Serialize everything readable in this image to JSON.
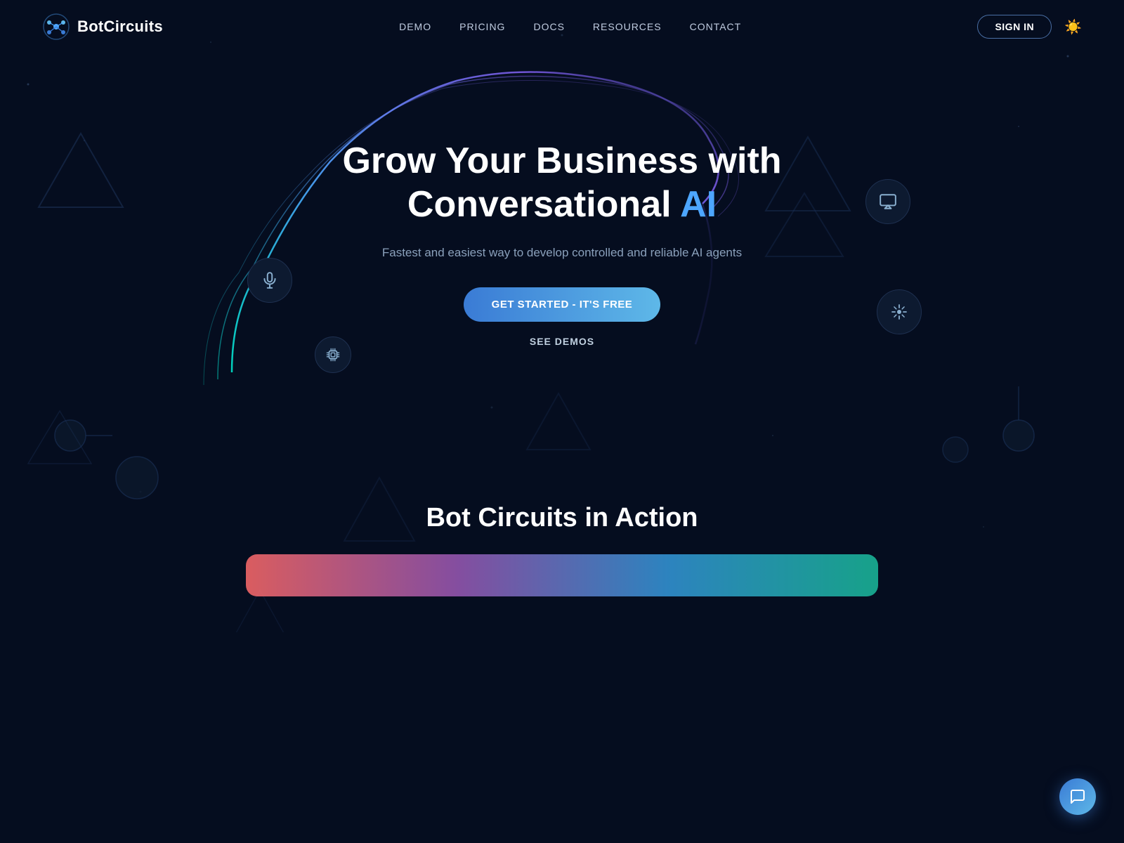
{
  "brand": {
    "name": "BotCircuits",
    "logo_alt": "BotCircuits logo"
  },
  "nav": {
    "links": [
      {
        "label": "DEMO",
        "id": "demo"
      },
      {
        "label": "PRICING",
        "id": "pricing"
      },
      {
        "label": "DOCS",
        "id": "docs"
      },
      {
        "label": "RESOURCES",
        "id": "resources"
      },
      {
        "label": "CONTACT",
        "id": "contact"
      }
    ],
    "sign_in": "SIGN IN"
  },
  "hero": {
    "title_line1": "Grow Your Business with",
    "title_line2": "Conversational ",
    "title_highlight": "AI",
    "subtitle": "Fastest and easiest way to develop controlled and reliable AI agents",
    "cta_primary": "GET STARTED - IT'S FREE",
    "cta_secondary": "SEE DEMOS"
  },
  "icons": {
    "mic": "🎤",
    "monitor": "🖥",
    "cursor": "✳",
    "chip": "🔲",
    "theme": "☀",
    "chat": "💬"
  },
  "bottom": {
    "title": "Bot Circuits in Action"
  }
}
